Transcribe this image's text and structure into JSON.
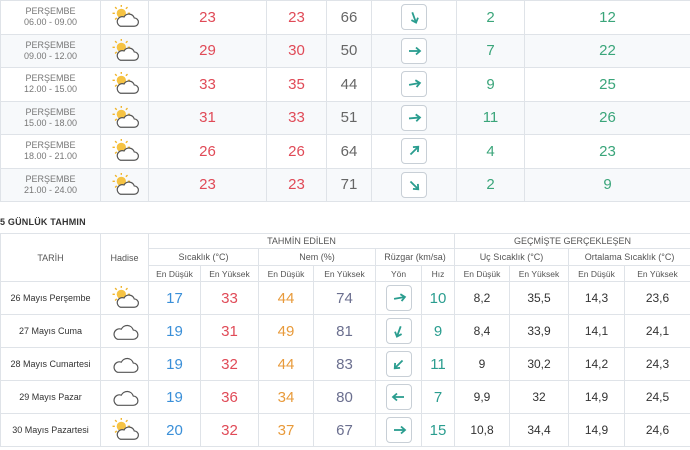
{
  "hourly": [
    {
      "day": "PERŞEMBE",
      "time": "06.00 - 09.00",
      "icon": "partly-cloudy-icon",
      "temp": "23",
      "feels": "23",
      "humidity": "66",
      "wind_dir": 160,
      "wind_speed": "2",
      "gust": "12"
    },
    {
      "day": "PERŞEMBE",
      "time": "09.00 - 12.00",
      "icon": "partly-cloudy-icon",
      "temp": "29",
      "feels": "30",
      "humidity": "50",
      "wind_dir": 90,
      "wind_speed": "7",
      "gust": "22"
    },
    {
      "day": "PERŞEMBE",
      "time": "12.00 - 15.00",
      "icon": "partly-cloudy-icon",
      "temp": "33",
      "feels": "35",
      "humidity": "44",
      "wind_dir": 80,
      "wind_speed": "9",
      "gust": "25"
    },
    {
      "day": "PERŞEMBE",
      "time": "15.00 - 18.00",
      "icon": "partly-cloudy-icon",
      "temp": "31",
      "feels": "33",
      "humidity": "51",
      "wind_dir": 85,
      "wind_speed": "11",
      "gust": "26"
    },
    {
      "day": "PERŞEMBE",
      "time": "18.00 - 21.00",
      "icon": "partly-cloudy-icon",
      "temp": "26",
      "feels": "26",
      "humidity": "64",
      "wind_dir": 45,
      "wind_speed": "4",
      "gust": "23"
    },
    {
      "day": "PERŞEMBE",
      "time": "21.00 - 24.00",
      "icon": "partly-cloudy-icon",
      "temp": "23",
      "feels": "23",
      "humidity": "71",
      "wind_dir": 135,
      "wind_speed": "2",
      "gust": "9"
    }
  ],
  "daily_title": "5 GÜNLÜK TAHMIN",
  "headers": {
    "date": "TARİH",
    "event": "Hadise",
    "forecast": "TAHMİN EDİLEN",
    "past": "GEÇMİŞTE GERÇEKLEŞEN",
    "temp": "Sıcaklık (°C)",
    "humidity": "Nem (%)",
    "wind": "Rüzgar (km/sa)",
    "extreme": "Uç Sıcaklık (°C)",
    "avg": "Ortalama Sıcaklık (°C)",
    "low": "En Düşük",
    "high": "En Yüksek",
    "dir": "Yön",
    "speed": "Hız"
  },
  "daily": [
    {
      "date": "26 Mayıs Perşembe",
      "icon": "partly-cloudy-icon",
      "tmin": "17",
      "tmax": "33",
      "hmin": "44",
      "hmax": "74",
      "wind_dir": 80,
      "speed": "10",
      "xmin": "8,2",
      "xmax": "35,5",
      "amin": "14,3",
      "amax": "23,6"
    },
    {
      "date": "27 Mayıs Cuma",
      "icon": "cloud-icon",
      "tmin": "19",
      "tmax": "31",
      "hmin": "49",
      "hmax": "81",
      "wind_dir": 200,
      "speed": "9",
      "xmin": "8,4",
      "xmax": "33,9",
      "amin": "14,1",
      "amax": "24,1"
    },
    {
      "date": "28 Mayıs Cumartesi",
      "icon": "cloud-icon",
      "tmin": "19",
      "tmax": "32",
      "hmin": "44",
      "hmax": "83",
      "wind_dir": 225,
      "speed": "11",
      "xmin": "9",
      "xmax": "30,2",
      "amin": "14,2",
      "amax": "24,3"
    },
    {
      "date": "29 Mayıs Pazar",
      "icon": "cloud-icon",
      "tmin": "19",
      "tmax": "36",
      "hmin": "34",
      "hmax": "80",
      "wind_dir": 270,
      "speed": "7",
      "xmin": "9,9",
      "xmax": "32",
      "amin": "14,9",
      "amax": "24,5"
    },
    {
      "date": "30 Mayıs Pazartesi",
      "icon": "partly-cloudy-icon",
      "tmin": "20",
      "tmax": "32",
      "hmin": "37",
      "hmax": "67",
      "wind_dir": 90,
      "speed": "15",
      "xmin": "10,8",
      "xmax": "34,4",
      "amin": "14,9",
      "amax": "24,6"
    }
  ]
}
